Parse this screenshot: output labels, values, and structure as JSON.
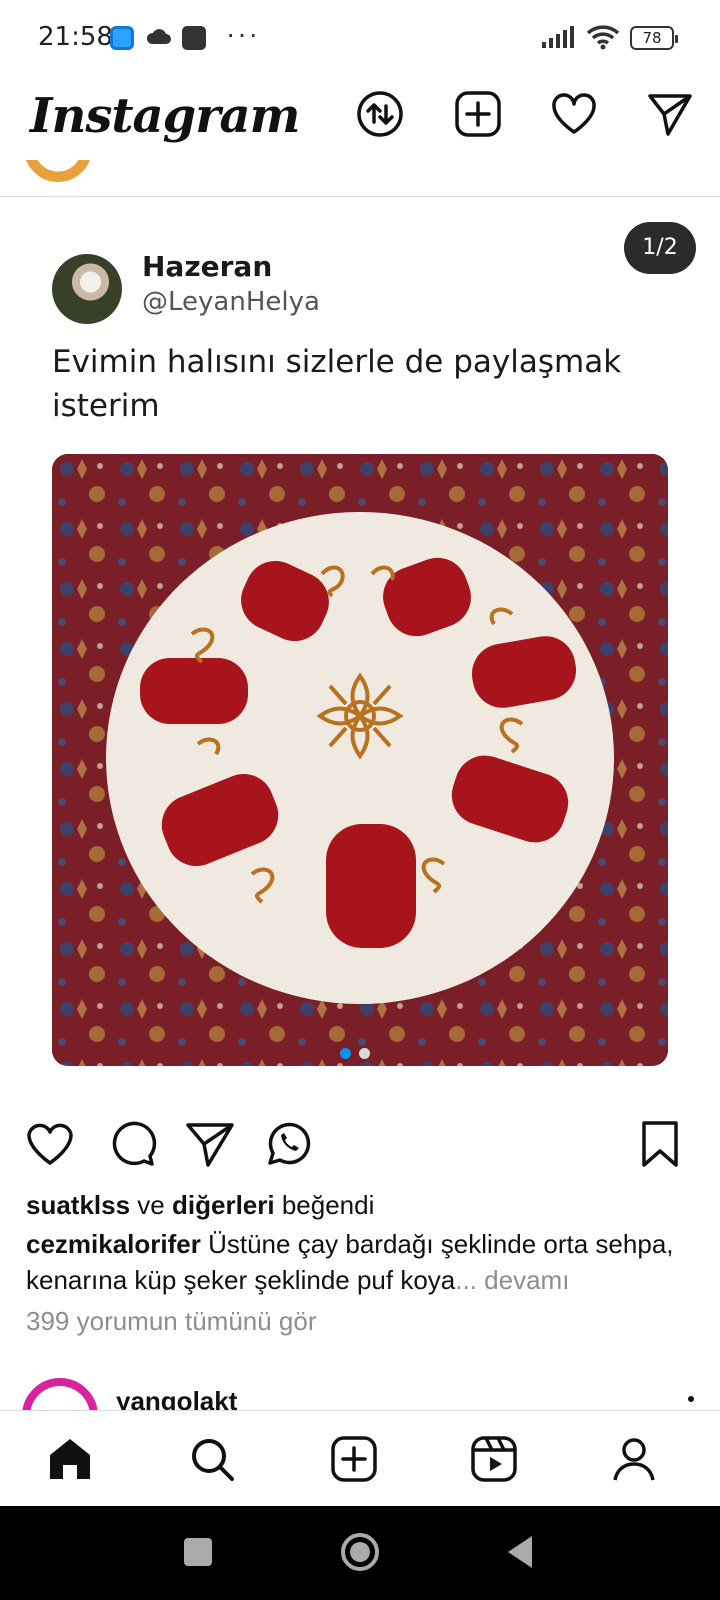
{
  "status_bar": {
    "time": "21:58",
    "more_dots": "···",
    "battery": "78"
  },
  "header": {
    "logo": "Instagram",
    "icons": [
      "sort-arrows-icon",
      "add-post-icon",
      "heart-icon",
      "direct-message-icon"
    ]
  },
  "post": {
    "slide_counter": "1/2",
    "tweet": {
      "name": "Hazeran",
      "handle": "@LeyanHelya",
      "text": "Evimin halısını sizlerle de paylaşmak isterim"
    },
    "carousel": {
      "current": 1,
      "total": 2
    },
    "likes": {
      "user": "suatklss",
      "connector": " ve ",
      "others": "diğerleri",
      "suffix": " beğendi"
    },
    "caption": {
      "user": "cezmikalorifer",
      "text": " Üstüne çay bardağı şeklinde orta sehpa, kenarına küp şeker şeklinde puf koya",
      "more": "... devamı"
    },
    "comments_link": "399 yorumun tümünü gör"
  },
  "next_post": {
    "username": "yangolakt"
  },
  "bottom_nav": [
    "home-icon",
    "search-icon",
    "create-icon",
    "reels-icon",
    "profile-icon"
  ],
  "colors": {
    "accent_blue": "#0095f6",
    "counter_bg": "#2b2b2b",
    "muted_text": "#8e8e8e",
    "rug_red": "#a8141c",
    "rug_cream": "#efe9df"
  }
}
